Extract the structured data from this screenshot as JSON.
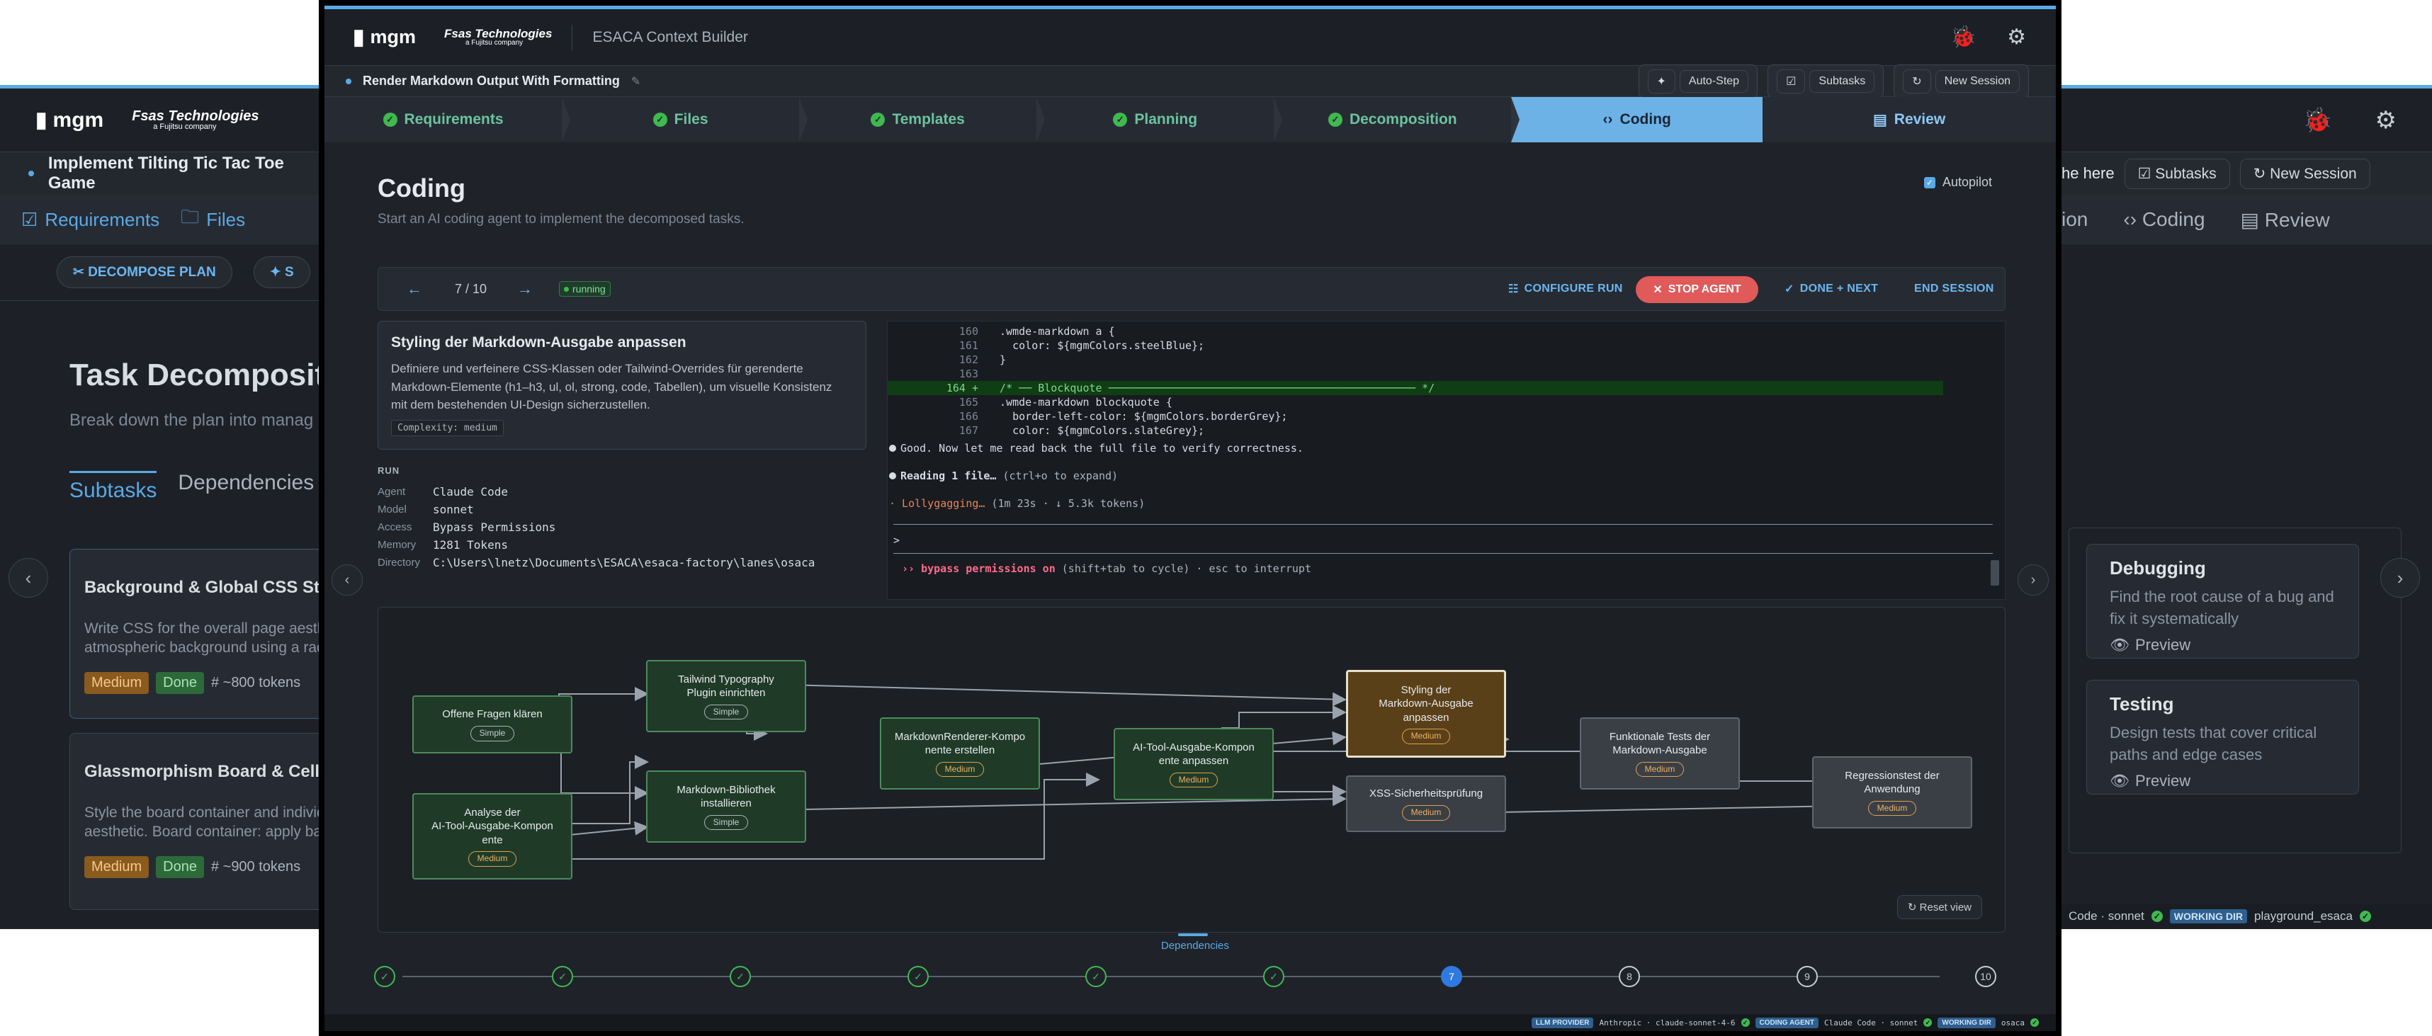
{
  "bg_left": {
    "logo": "mgm",
    "fsas": "Fsas Technologies",
    "fsas_sub": "a Fujitsu company",
    "project": "Implement Tilting Tic Tac Toe Game",
    "steps": [
      "Requirements",
      "Files"
    ],
    "tools": [
      "DECOMPOSE PLAN",
      "S"
    ],
    "title": "Task Decomposit",
    "subtitle": "Break down the plan into manag",
    "tabs": [
      "Subtasks",
      "Dependencies"
    ],
    "cards": [
      {
        "title": "Background & Global CSS Styling",
        "desc1": "Write CSS for the overall page aesthetic",
        "desc2": "atmospheric background using a radia",
        "complexity": "Medium",
        "status": "Done",
        "tokens": "# ~800 tokens"
      },
      {
        "title": "Glassmorphism Board & Cell CSS",
        "desc1": "Style the board container and individu",
        "desc2": "aesthetic. Board container: apply back",
        "complexity": "Medium",
        "status": "Done",
        "tokens": "# ~900 tokens"
      }
    ]
  },
  "bg_right": {
    "project_tail": "he here",
    "actions": [
      "Subtasks",
      "New Session"
    ],
    "steps": [
      "ion",
      "Coding",
      "Review"
    ],
    "cards": [
      {
        "title": "Debugging",
        "desc": "Find the root cause of a bug and fix it systematically",
        "preview": "Preview"
      },
      {
        "title": "Testing",
        "desc": "Design tests that cover critical paths and edge cases",
        "preview": "Preview"
      }
    ],
    "footer": {
      "provider_tail": "Code · sonnet",
      "wd_label": "WORKING DIR",
      "wd": "playground_esaca"
    }
  },
  "main": {
    "logo": "mgm",
    "fsas": "Fsas Technologies",
    "fsas_sub": "a Fujitsu company",
    "app_title": "ESACA Context Builder",
    "project": "Render Markdown Output With Formatting",
    "actions": {
      "autostep": "Auto-Step",
      "subtasks": "Subtasks",
      "newsession": "New Session"
    },
    "steps": [
      "Requirements",
      "Files",
      "Templates",
      "Planning",
      "Decomposition",
      "Coding",
      "Review"
    ],
    "page_title": "Coding",
    "page_subtitle": "Start an AI coding agent to implement the decomposed tasks.",
    "autopilot": "Autopilot",
    "run": {
      "position": "7 / 10",
      "status": "running",
      "configure": "CONFIGURE RUN",
      "stop": "STOP AGENT",
      "done_next": "DONE + NEXT",
      "end": "END SESSION"
    },
    "task": {
      "title": "Styling der Markdown-Ausgabe anpassen",
      "desc1": "Definiere und verfeinere CSS-Klassen oder Tailwind-Overrides für gerenderte",
      "desc2": "Markdown-Elemente (h1–h3, ul, ol, strong, code, Tabellen), um visuelle Konsistenz",
      "desc3": "mit dem bestehenden UI-Design sicherzustellen.",
      "complexity": "Complexity: medium"
    },
    "runmeta": {
      "heading": "RUN",
      "rows": [
        {
          "k": "Agent",
          "v": "Claude Code"
        },
        {
          "k": "Model",
          "v": "sonnet"
        },
        {
          "k": "Access",
          "v": "Bypass Permissions"
        },
        {
          "k": "Memory",
          "v": "1281 Tokens"
        },
        {
          "k": "Directory",
          "v": "C:\\Users\\lnetz\\Documents\\ESACA\\esaca-factory\\lanes\\osaca"
        }
      ]
    },
    "terminal": {
      "lines": [
        {
          "no": "160",
          "code": "  .wmde-markdown a {"
        },
        {
          "no": "161",
          "code": "    color: ${mgmColors.steelBlue};"
        },
        {
          "no": "162",
          "code": "  }"
        },
        {
          "no": "163",
          "code": ""
        },
        {
          "no": "164 +",
          "code": "  /* ── Blockquote ──────────────────────────────────────────────── */"
        },
        {
          "no": "165",
          "code": "  .wmde-markdown blockquote {"
        },
        {
          "no": "166",
          "code": "    border-left-color: ${mgmColors.borderGrey};"
        },
        {
          "no": "167",
          "code": "    color: ${mgmColors.slateGrey};"
        }
      ],
      "msg1": "Good. Now let me read back the full file to verify correctness.",
      "msg2a": "Reading 1 file…",
      "msg2b": " (ctrl+o to expand)",
      "msg3a": "· Lollygagging…",
      "msg3b": " (1m 23s · ↓ 5.3k tokens)",
      "prompt": ">",
      "perm_a": "›› bypass permissions on",
      "perm_b": " (shift+tab to cycle) · esc to interrupt"
    },
    "graph": {
      "nodes": [
        {
          "id": "n1",
          "label1": "Offene Fragen klären",
          "label2": "",
          "label3": "",
          "badge": "Simple",
          "tone": "green"
        },
        {
          "id": "n2",
          "label1": "Analyse der",
          "label2": "AI-Tool-Ausgabe-Kompon",
          "label3": "ente",
          "badge": "Medium",
          "tone": "green"
        },
        {
          "id": "n3",
          "label1": "Tailwind Typography",
          "label2": "Plugin einrichten",
          "label3": "",
          "badge": "Simple",
          "tone": "green"
        },
        {
          "id": "n4",
          "label1": "Markdown-Bibliothek",
          "label2": "installieren",
          "label3": "",
          "badge": "Simple",
          "tone": "green"
        },
        {
          "id": "n5",
          "label1": "MarkdownRenderer-Kompo",
          "label2": "nente erstellen",
          "label3": "",
          "badge": "Medium",
          "tone": "green"
        },
        {
          "id": "n6",
          "label1": "AI-Tool-Ausgabe-Kompon",
          "label2": "ente anpassen",
          "label3": "",
          "badge": "Medium",
          "tone": "green"
        },
        {
          "id": "n7",
          "label1": "Styling der",
          "label2": "Markdown-Ausgabe",
          "label3": "anpassen",
          "badge": "Medium",
          "tone": "current"
        },
        {
          "id": "n8",
          "label1": "XSS-Sicherheitsprüfung",
          "label2": "",
          "label3": "",
          "badge": "Medium",
          "tone": "grey"
        },
        {
          "id": "n9",
          "label1": "Funktionale Tests der",
          "label2": "Markdown-Ausgabe",
          "label3": "",
          "badge": "Medium",
          "tone": "grey"
        },
        {
          "id": "n10",
          "label1": "Regressionstest der",
          "label2": "Anwendung",
          "label3": "",
          "badge": "Medium",
          "tone": "grey"
        }
      ],
      "reset": "Reset view"
    },
    "progress": {
      "label": "Dependencies",
      "steps": [
        {
          "label": "✓",
          "state": "done"
        },
        {
          "label": "✓",
          "state": "done"
        },
        {
          "label": "✓",
          "state": "done"
        },
        {
          "label": "✓",
          "state": "done"
        },
        {
          "label": "✓",
          "state": "done"
        },
        {
          "label": "✓",
          "state": "done"
        },
        {
          "label": "7",
          "state": "current"
        },
        {
          "label": "8",
          "state": "todo"
        },
        {
          "label": "9",
          "state": "todo"
        },
        {
          "label": "10",
          "state": "todo"
        }
      ]
    },
    "footer": {
      "llm_label": "LLM PROVIDER",
      "llm": "Anthropic · claude-sonnet-4-6",
      "agent_label": "CODING AGENT",
      "agent": "Claude Code · sonnet",
      "wd_label": "WORKING DIR",
      "wd": "osaca"
    }
  },
  "colors": {
    "accent": "#5aa9e6",
    "success": "#3fb950",
    "danger": "#e05a5a",
    "medium": "#e0a050"
  }
}
